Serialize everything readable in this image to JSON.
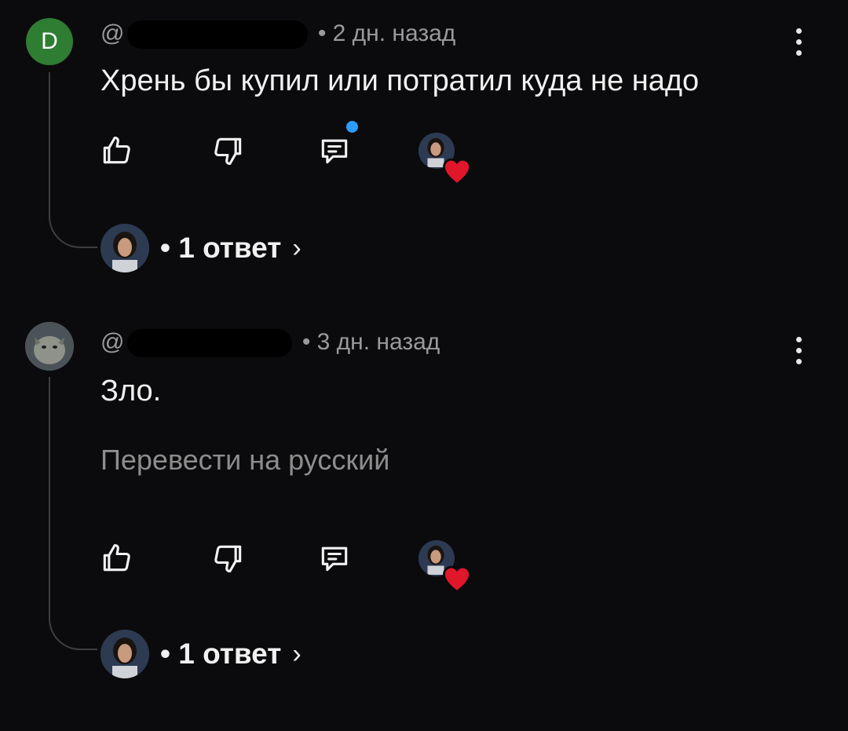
{
  "comments": [
    {
      "avatar_letter": "D",
      "handle_visible": "@",
      "meta": "• 2 дн. назад",
      "text": "Хрень бы купил или потратил куда не надо",
      "translate": "",
      "replies": {
        "prefix": "•",
        "count_label": "1 ответ",
        "chevron": "›"
      },
      "has_new_indicator": true
    },
    {
      "avatar_letter": "",
      "handle_visible": "@",
      "meta": "• 3 дн. назад",
      "text": "Зло.",
      "translate": "Перевести на русский",
      "replies": {
        "prefix": "•",
        "count_label": "1 ответ",
        "chevron": "›"
      },
      "has_new_indicator": false
    }
  ],
  "icons": {
    "like": "thumbs-up-icon",
    "dislike": "thumbs-down-icon",
    "reply": "comment-icon",
    "creator_heart": "heart-icon",
    "menu": "more-vert-icon"
  },
  "colors": {
    "background": "#0b0b0d",
    "accent_dot": "#2d9cff",
    "heart": "#e0162b",
    "avatar_d": "#2e7d32"
  }
}
